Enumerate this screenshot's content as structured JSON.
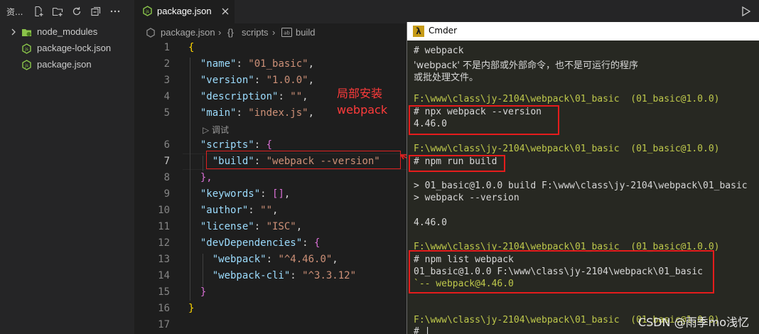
{
  "sidebar": {
    "title": "资...",
    "actions": [
      "new-file-icon",
      "new-folder-icon",
      "refresh-icon",
      "collapse-all-icon",
      "more-icon"
    ],
    "items": [
      {
        "label": "node_modules",
        "type": "folder"
      },
      {
        "label": "package-lock.json",
        "type": "json"
      },
      {
        "label": "package.json",
        "type": "json"
      }
    ]
  },
  "tab": {
    "label": "package.json",
    "close_icon": "close-icon"
  },
  "breadcrumb": {
    "file": "package.json",
    "sep": "›",
    "scripts": "scripts",
    "build": "build",
    "scripts_prefix": "{}"
  },
  "editor": {
    "line_numbers": [
      "1",
      "2",
      "3",
      "4",
      "5",
      "",
      "6",
      "7",
      "8",
      "9",
      "10",
      "11",
      "12",
      "13",
      "14",
      "15",
      "16",
      "17"
    ],
    "current_line": "7",
    "debug_lens": "▷ 调试",
    "code": {
      "l1": "{",
      "l2k": "\"name\"",
      "l2v": "\"01_basic\"",
      "l3k": "\"version\"",
      "l3v": "\"1.0.0\"",
      "l4k": "\"description\"",
      "l4v": "\"\"",
      "l5k": "\"main\"",
      "l5v": "\"index.js\"",
      "l6k": "\"scripts\"",
      "l6v": "{",
      "l7k": "\"build\"",
      "l7v": "\"webpack --version\"",
      "l8": "},",
      "l9k": "\"keywords\"",
      "l9v": "[]",
      "l10k": "\"author\"",
      "l10v": "\"\"",
      "l11k": "\"license\"",
      "l11v": "\"ISC\"",
      "l12k": "\"devDependencies\"",
      "l12v": "{",
      "l13k": "\"webpack\"",
      "l13v": "\"^4.46.0\"",
      "l14k": "\"webpack-cli\"",
      "l14v": "\"^3.3.12\"",
      "l15": "}",
      "l16": "}"
    }
  },
  "annotation": {
    "line1": "局部安装",
    "line2": "webpack",
    "color": "#ff3b3b"
  },
  "cmder": {
    "title": "Cmder",
    "logo": "λ",
    "lines": [
      "# webpack",
      "'webpack' 不是内部或外部命令，也不是可运行的程序",
      "或批处理文件。",
      "F:\\www\\class\\jy-2104\\webpack\\01_basic  (01_basic@1.0.0)",
      "# npx webpack --version",
      "4.46.0",
      "F:\\www\\class\\jy-2104\\webpack\\01_basic  (01_basic@1.0.0)",
      "# npm run build",
      "> 01_basic@1.0.0 build F:\\www\\class\\jy-2104\\webpack\\01_basic",
      "> webpack --version",
      "4.46.0",
      "F:\\www\\class\\jy-2104\\webpack\\01_basic  (01_basic@1.0.0)",
      "# npm list webpack",
      "01_basic@1.0.0 F:\\www\\class\\jy-2104\\webpack\\01_basic",
      "`-- webpack@4.46.0",
      "F:\\www\\class\\jy-2104\\webpack\\01_basic  (01_basic@1.0.0)",
      "# |"
    ]
  },
  "watermark": "CSDN @雨季mo浅忆",
  "colors": {
    "editor_bg": "#1e1e1e",
    "sidebar_bg": "#252526",
    "terminal_bg": "#272822",
    "key": "#9cdcfe",
    "string": "#ce9178",
    "prompt": "#bfc94b",
    "highlight_box": "#e51c1c"
  }
}
